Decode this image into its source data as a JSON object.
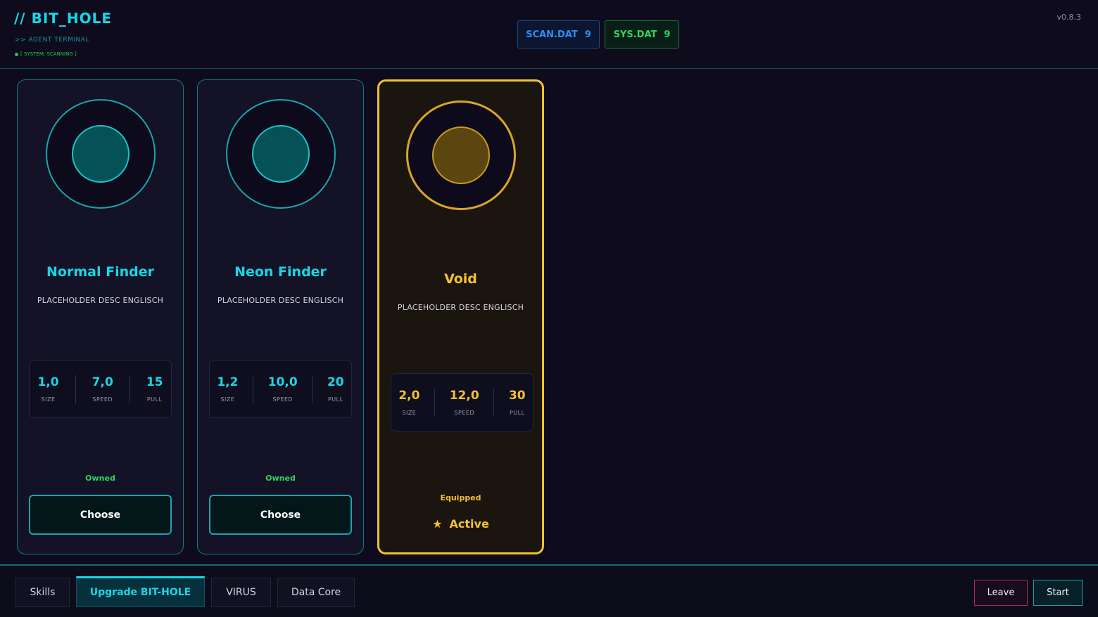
{
  "header": {
    "logo": "// BIT_HOLE",
    "subtitle": ">> AGENT TERMINAL",
    "status": "[ SYSTEM: SCANNING ]",
    "version": "v0.8.3",
    "scan": {
      "label": "SCAN.DAT",
      "value": "9"
    },
    "sys": {
      "label": "SYS.DAT",
      "value": "9"
    }
  },
  "cards": [
    {
      "title": "Normal Finder",
      "desc": "PLACEHOLDER DESC ENGLISCH",
      "stats": [
        {
          "value": "1,0",
          "label": "SIZE"
        },
        {
          "value": "7,0",
          "label": "SPEED"
        },
        {
          "value": "15",
          "label": "PULL"
        }
      ],
      "status": "Owned",
      "action": "Choose"
    },
    {
      "title": "Neon Finder",
      "desc": "PLACEHOLDER DESC ENGLISCH",
      "stats": [
        {
          "value": "1,2",
          "label": "SIZE"
        },
        {
          "value": "10,0",
          "label": "SPEED"
        },
        {
          "value": "20",
          "label": "PULL"
        }
      ],
      "status": "Owned",
      "action": "Choose"
    },
    {
      "title": "Void",
      "desc": "PLACEHOLDER DESC ENGLISCH",
      "stats": [
        {
          "value": "2,0",
          "label": "SIZE"
        },
        {
          "value": "12,0",
          "label": "SPEED"
        },
        {
          "value": "30",
          "label": "PULL"
        }
      ],
      "status": "Equipped",
      "action": "Active"
    }
  ],
  "footer": {
    "tabs": [
      "Skills",
      "Upgrade BIT-HOLE",
      "VIRUS",
      "Data Core"
    ],
    "active_tab": "Upgrade BIT-HOLE",
    "leave": "Leave",
    "start": "Start"
  },
  "colors": {
    "accent": "#19d6e6",
    "active": "#f5c132",
    "owned": "#2fd55f",
    "scan": "#2e8df5",
    "leave_border": "#b0256a"
  },
  "icons": {
    "active_marker": "star-icon"
  }
}
